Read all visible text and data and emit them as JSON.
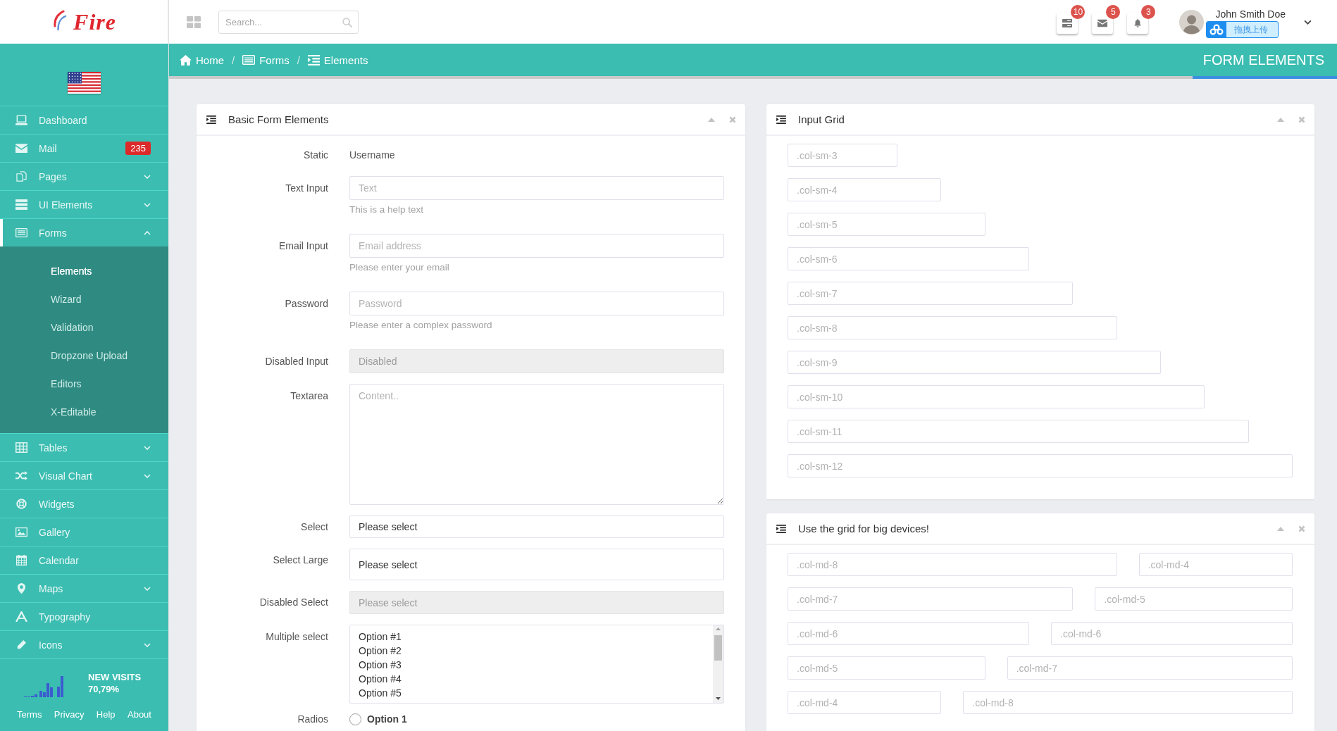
{
  "brand": {
    "logo": "Fire"
  },
  "topbar": {
    "search": {
      "placeholder": "Search..."
    },
    "notifications": [
      {
        "count": "10"
      },
      {
        "count": "5"
      },
      {
        "count": "3"
      }
    ],
    "user": {
      "name": "John Smith Doe"
    },
    "upload_overlay": {
      "label": "拖拽上传"
    }
  },
  "breadcrumb": [
    {
      "label": "Home"
    },
    {
      "separator": "/",
      "label": "Forms"
    },
    {
      "separator": "/",
      "label": "Elements"
    }
  ],
  "page_title": "FORM ELEMENTS",
  "sidebar": {
    "items": [
      {
        "label": "Dashboard",
        "kind": "link",
        "selected": false,
        "expanded": false
      },
      {
        "label": "Mail",
        "kind": "link",
        "selected": false,
        "expanded": false,
        "badge": "235"
      },
      {
        "label": "Pages",
        "kind": "group",
        "selected": false,
        "expanded": false
      },
      {
        "label": "UI Elements",
        "kind": "group",
        "selected": false,
        "expanded": false
      },
      {
        "label": "Forms",
        "kind": "group",
        "selected": true,
        "expanded": true,
        "children": [
          {
            "label": "Elements",
            "selected": true
          },
          {
            "label": "Wizard",
            "selected": false
          },
          {
            "label": "Validation",
            "selected": false
          },
          {
            "label": "Dropzone Upload",
            "selected": false
          },
          {
            "label": "Editors",
            "selected": false
          },
          {
            "label": "X-Editable",
            "selected": false
          }
        ]
      },
      {
        "label": "Tables",
        "kind": "group",
        "selected": false,
        "expanded": false
      },
      {
        "label": "Visual Chart",
        "kind": "group",
        "selected": false,
        "expanded": false
      },
      {
        "label": "Widgets",
        "kind": "link",
        "selected": false,
        "expanded": false
      },
      {
        "label": "Gallery",
        "kind": "link",
        "selected": false,
        "expanded": false
      },
      {
        "label": "Calendar",
        "kind": "link",
        "selected": false,
        "expanded": false
      },
      {
        "label": "Maps",
        "kind": "group",
        "selected": false,
        "expanded": false
      },
      {
        "label": "Typography",
        "kind": "link",
        "selected": false,
        "expanded": false
      },
      {
        "label": "Icons",
        "kind": "group",
        "selected": false,
        "expanded": false
      }
    ],
    "stats": {
      "label": "NEW VISITS",
      "value": "70,79%"
    },
    "footer_links": [
      "Terms",
      "Privacy",
      "Help",
      "About"
    ]
  },
  "form_panel": {
    "title": "Basic Form Elements",
    "fields": [
      {
        "kind": "static",
        "label": "Static",
        "value": "Username"
      },
      {
        "kind": "input",
        "label": "Text Input",
        "placeholder": "Text",
        "help": "This is a help text",
        "disabled": false
      },
      {
        "kind": "input",
        "label": "Email Input",
        "placeholder": "Email address",
        "help": "Please enter your email",
        "disabled": false
      },
      {
        "kind": "input",
        "label": "Password",
        "placeholder": "Password",
        "help": "Please enter a complex password",
        "disabled": false
      },
      {
        "kind": "input",
        "label": "Disabled Input",
        "placeholder": "Disabled",
        "disabled": true
      },
      {
        "kind": "textarea",
        "label": "Textarea",
        "placeholder": "Content.."
      },
      {
        "kind": "select",
        "label": "Select",
        "value": "Please select",
        "large": false,
        "disabled": false
      },
      {
        "kind": "select",
        "label": "Select Large",
        "value": "Please select",
        "large": true,
        "disabled": false
      },
      {
        "kind": "select",
        "label": "Disabled Select",
        "value": "Please select",
        "large": false,
        "disabled": true
      },
      {
        "kind": "multiselect",
        "label": "Multiple select",
        "options": [
          {
            "label": "Option #1",
            "selected": false
          },
          {
            "label": "Option #2",
            "selected": false
          },
          {
            "label": "Option #3",
            "selected": false
          },
          {
            "label": "Option #4",
            "selected": false
          },
          {
            "label": "Option #5",
            "selected": false
          }
        ]
      },
      {
        "kind": "radios",
        "label": "Radios",
        "options": [
          {
            "label": "Option 1",
            "selected": false
          }
        ]
      }
    ]
  },
  "grid_panels": [
    {
      "title": "Input Grid",
      "rows": [
        [
          {
            "placeholder": ".col-sm-3"
          }
        ],
        [
          {
            "placeholder": ".col-sm-4"
          }
        ],
        [
          {
            "placeholder": ".col-sm-5"
          }
        ],
        [
          {
            "placeholder": ".col-sm-6"
          }
        ],
        [
          {
            "placeholder": ".col-sm-7"
          }
        ],
        [
          {
            "placeholder": ".col-sm-8"
          }
        ],
        [
          {
            "placeholder": ".col-sm-9"
          }
        ],
        [
          {
            "placeholder": ".col-sm-10"
          }
        ],
        [
          {
            "placeholder": ".col-sm-11"
          }
        ],
        [
          {
            "placeholder": ".col-sm-12"
          }
        ]
      ]
    },
    {
      "title": "Use the grid for big devices!",
      "rows": [
        [
          {
            "placeholder": ".col-md-8"
          },
          {
            "placeholder": ".col-md-4"
          }
        ],
        [
          {
            "placeholder": ".col-md-7"
          },
          {
            "placeholder": ".col-md-5"
          }
        ],
        [
          {
            "placeholder": ".col-md-6"
          },
          {
            "placeholder": ".col-md-6"
          }
        ],
        [
          {
            "placeholder": ".col-md-5"
          },
          {
            "placeholder": ".col-md-7"
          }
        ],
        [
          {
            "placeholder": ".col-md-4"
          },
          {
            "placeholder": ".col-md-8"
          }
        ]
      ]
    }
  ]
}
